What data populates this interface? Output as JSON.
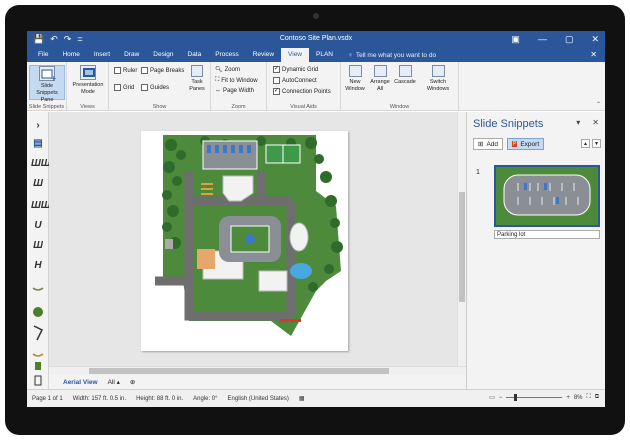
{
  "window": {
    "title": "Contoso Site Plan.vsdx",
    "qat": [
      "💾",
      "↶",
      "↷",
      "="
    ],
    "controls": [
      "▣",
      "—",
      "▢",
      "✕"
    ]
  },
  "tabs": [
    "File",
    "Home",
    "Insert",
    "Draw",
    "Design",
    "Data",
    "Process",
    "Review",
    "View",
    "PLAN"
  ],
  "active_tab": "View",
  "tell_me": "Tell me what you want to do",
  "ribbon": {
    "slide_snippets": {
      "label": "Slide Snippets Pane",
      "group": "Slide Snippets"
    },
    "presentation": {
      "label": "Presentation Mode",
      "group": "Views"
    },
    "show": {
      "ruler": "Ruler",
      "page_breaks": "Page Breaks",
      "grid": "Grid",
      "guides": "Guides",
      "task_panes": "Task Panes",
      "group": "Show"
    },
    "zoom": {
      "zoom": "Zoom",
      "fit": "Fit to Window",
      "page_width": "Page Width",
      "group": "Zoom"
    },
    "visual_aids": {
      "dynamic_grid": "Dynamic Grid",
      "autoconnect": "AutoConnect",
      "connection_points": "Connection Points",
      "group": "Visual Aids"
    },
    "window": {
      "new": "New Window",
      "arrange": "Arrange All",
      "cascade": "Cascade",
      "switch": "Switch Windows",
      "group": "Window"
    }
  },
  "stencil_glyphs": [
    "›",
    "▤",
    "ШШ",
    "Ш",
    "ШШ",
    "U",
    "Ш",
    "H"
  ],
  "page_tabs": {
    "current": "Aerial View",
    "all": "All ▴",
    "add": "⊕"
  },
  "pane": {
    "title": "Slide Snippets",
    "add_label": "Add",
    "export_label": "Export",
    "snippet_number": "1",
    "snippet_name": "Parking lot"
  },
  "status": {
    "page": "Page 1 of 1",
    "width": "Width: 157 ft. 0.5 in.",
    "height": "Height: 88 ft. 0 in.",
    "angle": "Angle: 0°",
    "language": "English (United States)",
    "zoom": "8%"
  }
}
